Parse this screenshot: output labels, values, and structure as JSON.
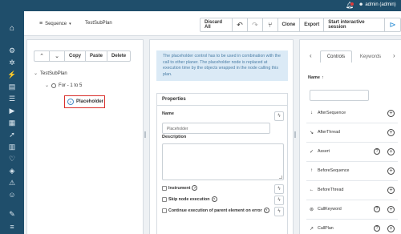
{
  "topbar": {
    "user_label": "admin (admin)"
  },
  "toolbar": {
    "sequence_label": "Sequence",
    "plan_name": "TestSubPlan",
    "discard_all": "Discard All",
    "clone": "Clone",
    "export": "Export",
    "start_session": "Start interactive session"
  },
  "tree": {
    "actions": {
      "copy": "Copy",
      "paste": "Paste",
      "delete": "Delete"
    },
    "nodes": [
      {
        "label": "TestSubPlan"
      },
      {
        "label": "For - 1 to 5"
      },
      {
        "label": "Placeholder"
      }
    ]
  },
  "properties": {
    "info_text": "The placeholder control has to be used in combination with the call to other planer. The placeholder node is replaced at execution time by the objects wrapped in the node calling this plan.",
    "title": "Properties",
    "name_label": "Name",
    "name_value": "Placeholder",
    "description_label": "Description",
    "instrument_label": "Instrument",
    "skip_label": "Skip node execution",
    "continue_label": "Continue execution of parent element on error"
  },
  "controls": {
    "tabs": [
      "Controls",
      "Keywords"
    ],
    "header": "Name",
    "items": [
      {
        "label": "AfterSequence",
        "icon": "arrow-down-icon",
        "glyph": "↓",
        "help": false
      },
      {
        "label": "AfterThread",
        "icon": "arrow-down-right-icon",
        "glyph": "↘",
        "help": false
      },
      {
        "label": "Assert",
        "icon": "check-icon",
        "glyph": "✓",
        "help": true
      },
      {
        "label": "BeforeSequence",
        "icon": "arrow-up-icon",
        "glyph": "↑",
        "help": false
      },
      {
        "label": "BeforeThread",
        "icon": "arrow-left-icon",
        "glyph": "←",
        "help": false
      },
      {
        "label": "CallKeyword",
        "icon": "keyword-icon",
        "glyph": "⊚",
        "help": true
      },
      {
        "label": "CallPlan",
        "icon": "call-plan-icon",
        "glyph": "↗",
        "help": true
      }
    ]
  },
  "colors": {
    "nav_bg": "#1f4e6b",
    "accent": "#2a8dd4",
    "info_bg": "#dbeaf6",
    "selection_border": "#d9302c"
  }
}
